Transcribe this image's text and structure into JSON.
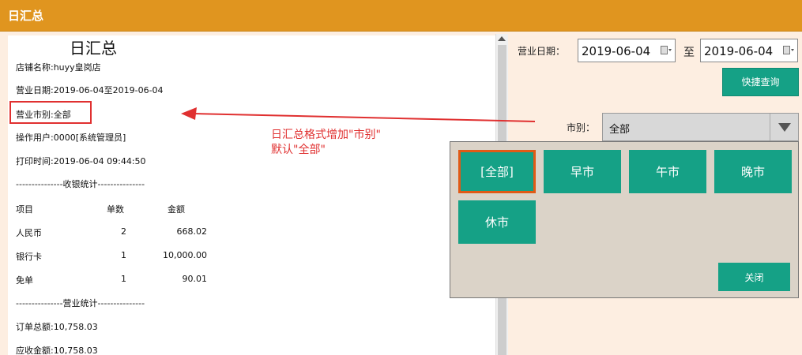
{
  "window": {
    "title": "日汇总"
  },
  "receipt": {
    "title": "日汇总",
    "store": "店铺名称:huyy皇岗店",
    "date_range": "营业日期:2019-06-04至2019-06-04",
    "market": "营业市别:全部",
    "operator": "操作用户:0000[系统管理员]",
    "print_time": "打印时间:2019-06-04 09:44:50",
    "sep_cashier": "---------------收银统计---------------",
    "headers": {
      "item": "项目",
      "count": "单数",
      "amount": "金额"
    },
    "rows": [
      {
        "item": "人民币",
        "count": "2",
        "amount": "668.02"
      },
      {
        "item": "银行卡",
        "count": "1",
        "amount": "10,000.00"
      },
      {
        "item": "免单",
        "count": "1",
        "amount": "90.01"
      }
    ],
    "sep_business": "---------------营业统计---------------",
    "order_total": "订单总额:10,758.03",
    "receivable": "应收金额:10,758.03"
  },
  "annotation": {
    "text": "日汇总格式增加\"市别\"\n默认\"全部\"",
    "color": "#e03030"
  },
  "filters": {
    "date_label": "营业日期：",
    "start_date": "2019-06-04",
    "to_label": "至",
    "end_date": "2019-06-04",
    "quick_query_label": "快捷查询",
    "market_label": "市别：",
    "market_value": "全部"
  },
  "popup": {
    "options": [
      "[全部]",
      "早市",
      "午市",
      "晚市",
      "休市"
    ],
    "selected_index": 0,
    "close_label": "关闭"
  },
  "colors": {
    "titlebar": "#e0951f",
    "accent": "#15a186",
    "highlight": "#e03030"
  }
}
